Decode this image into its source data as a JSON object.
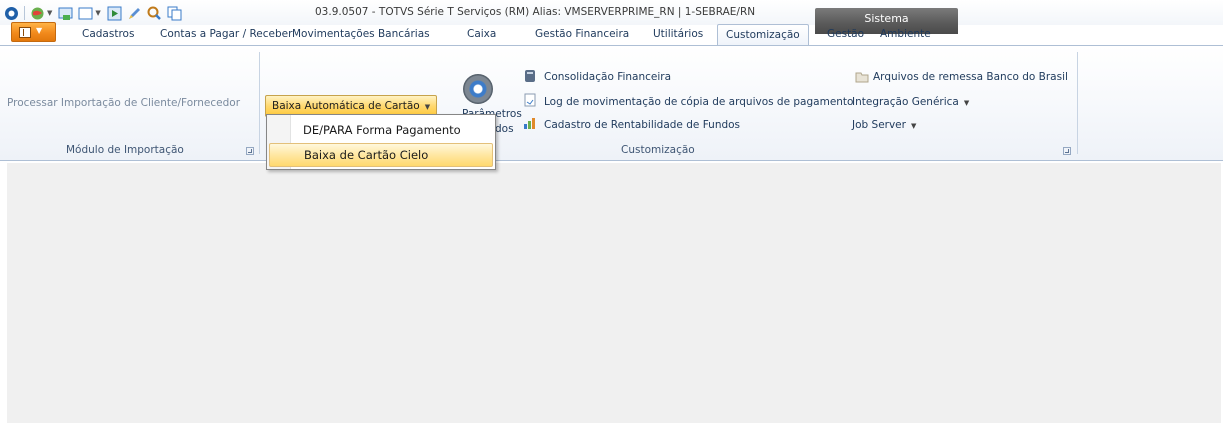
{
  "window": {
    "title": "03.9.0507 - TOTVS Série T Serviços (RM) Alias: VMSERVERPRIME_RN | 1-SEBRAE/RN",
    "context_tab": "Sistema"
  },
  "tabs": [
    "Cadastros",
    "Contas a Pagar / Receber",
    "Movimentações Bancárias",
    "Caixa",
    "Gestão Financeira",
    "Utilitários",
    "Customização",
    "Gestão",
    "Ambiente"
  ],
  "active_tab": "Customização",
  "ribbon": {
    "modulo_importacao": {
      "processar": "Processar Importação de Cliente/Fornecedor",
      "group_label": "Módulo de Importação"
    },
    "baixa_group": {
      "baixa_button": "Baixa Automática de Cartão",
      "parametros_line1": "Parâmetros",
      "parametros_line2": "dos"
    },
    "customizacao": {
      "consolidacao": "Consolidação Financeira",
      "log_movimentacao": "Log de movimentação de cópia de arquivos de pagamento",
      "cadastro_rentabilidade": "Cadastro de Rentabilidade de Fundos",
      "arquivos_remessa": "Arquivos de remessa Banco do Brasil",
      "integracao_generica": "Integração Genérica",
      "job_server": "Job Server",
      "group_label": "Customização"
    }
  },
  "dropdown": {
    "items": [
      "DE/PARA Forma Pagamento",
      "Baixa de Cartão Cielo"
    ],
    "hovered": "Baixa de Cartão Cielo"
  },
  "colors": {
    "ribbon_text": "#1e395b",
    "app_button": "#f28a1c",
    "context_tab": "#5a5a5a",
    "highlight": "#ffd96f",
    "content_bg": "#f0f0f0"
  }
}
